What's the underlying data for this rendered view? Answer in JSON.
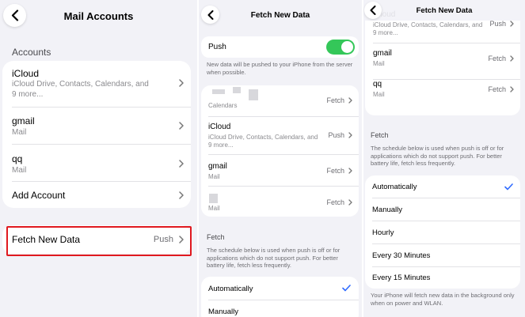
{
  "colors": {
    "background": "#f2f2f7",
    "card": "#ffffff",
    "highlight": "#e0191f",
    "toggle_on": "#34c759",
    "check": "#2f6bff"
  },
  "icons": {
    "back": "chevron-left-icon",
    "row": "chevron-right-icon",
    "selected": "checkmark-icon"
  },
  "panel1": {
    "title": "Mail Accounts",
    "section_header": "Accounts",
    "accounts": [
      {
        "name": "iCloud",
        "sub1": "iCloud Drive, Contacts, Calendars, and",
        "sub2": "9 more..."
      },
      {
        "name": "gmail",
        "sub1": "Mail"
      },
      {
        "name": "qq",
        "sub1": "Mail"
      },
      {
        "name": "Add Account"
      }
    ],
    "fetch_new_data": {
      "label": "Fetch New Data",
      "value": "Push"
    }
  },
  "panel2": {
    "title": "Fetch New Data",
    "push": {
      "label": "Push",
      "enabled": true
    },
    "push_note1": "New data will be pushed to your iPhone from the server",
    "push_note2": "when possible.",
    "accounts": [
      {
        "sub1": "Calendars",
        "value": "Fetch"
      },
      {
        "name": "iCloud",
        "sub1": "iCloud Drive, Contacts, Calendars, and",
        "sub2": "9 more...",
        "value": "Push"
      },
      {
        "name": "gmail",
        "sub1": "Mail",
        "value": "Fetch"
      },
      {
        "sub1": "Mail",
        "value": "Fetch"
      }
    ],
    "fetch_header": "Fetch",
    "fetch_note1": "The schedule below is used when push is off or for",
    "fetch_note2": "applications which do not support push. For better",
    "fetch_note3": "battery life, fetch less frequently.",
    "schedule": [
      {
        "label": "Automatically",
        "selected": true
      },
      {
        "label": "Manually",
        "selected": false
      }
    ]
  },
  "panel3": {
    "title": "Fetch New Data",
    "accounts": [
      {
        "name": "iCloud",
        "sub1": "iCloud Drive, Contacts, Calendars, and",
        "sub2": "9 more...",
        "value": "Push"
      },
      {
        "name": "gmail",
        "sub1": "Mail",
        "value": "Fetch"
      },
      {
        "name": "qq",
        "sub1": "Mail",
        "value": "Fetch"
      }
    ],
    "fetch_header": "Fetch",
    "fetch_note1": "The schedule below is used when push is off or for",
    "fetch_note2": "applications which do not support push. For better",
    "fetch_note3": "battery life, fetch less frequently.",
    "schedule": [
      {
        "label": "Automatically",
        "selected": true
      },
      {
        "label": "Manually",
        "selected": false
      },
      {
        "label": "Hourly",
        "selected": false
      },
      {
        "label": "Every 30 Minutes",
        "selected": false
      },
      {
        "label": "Every 15 Minutes",
        "selected": false
      }
    ],
    "footer1": "Your iPhone will fetch new data in the background only",
    "footer2": "when on power and WLAN."
  }
}
